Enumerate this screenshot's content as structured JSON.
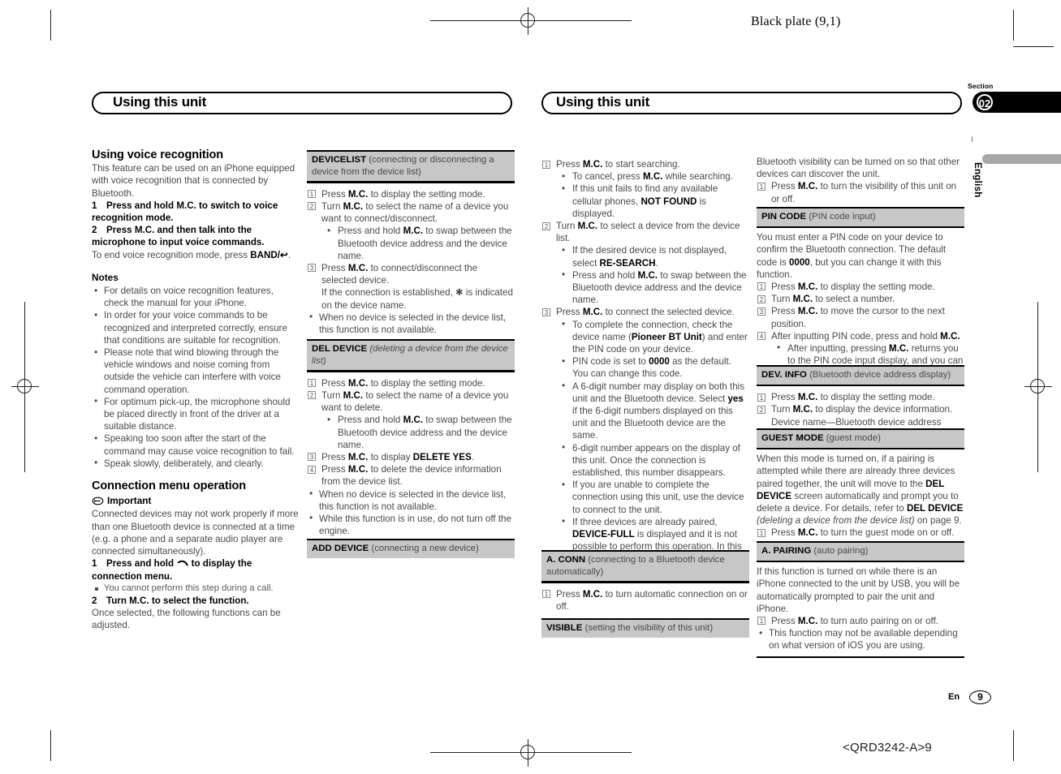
{
  "print_marks": {
    "black_plate": "Black plate (9,1)",
    "code": "<QRD3242-A>9"
  },
  "left_page": {
    "banner_title": "Using this unit",
    "column1": {
      "heading": "Using voice recognition",
      "intro": "This feature can be used on an iPhone equipped with voice recognition that is connected by Bluetooth.",
      "step1": "Press and hold M.C. to switch to voice recognition mode.",
      "step1_num": "1",
      "step2": "Press M.C. and then talk into the microphone to input voice commands.",
      "step2_num": "2",
      "step2_sub": "To end voice recognition mode, press BAND/",
      "notes_heading": "Notes",
      "notes": [
        "For details on voice recognition features, check the manual for your iPhone.",
        "In order for your voice commands to be recognized and interpreted correctly, ensure that conditions are suitable for recognition.",
        "Please note that wind blowing through the vehicle windows and noise coming from outside the vehicle can interfere with voice command operation.",
        "For optimum pick-up, the microphone should be placed directly in front of the driver at a suitable distance.",
        "Speaking too soon after the start of the command may cause voice recognition to fail.",
        "Speak slowly, deliberately, and clearly."
      ],
      "connection_heading": "Connection menu operation",
      "important_label": "Important",
      "important_text": "Connected devices may not work properly if more than one Bluetooth device is connected at a time (e.g. a phone and a separate audio player are connected simultaneously).",
      "conn_step1_num": "1",
      "conn_step1_a": "Press and hold",
      "conn_step1_b": "to display the connection menu.",
      "conn_step1_note": "You cannot perform this step during a call.",
      "conn_step2_num": "2",
      "conn_step2": "Turn M.C. to select the function.",
      "conn_step2_sub": "Once selected, the following functions can be adjusted."
    },
    "column2": {
      "devicelist": {
        "name": "DEVICELIST",
        "desc": "(connecting or disconnecting a device from the device list)",
        "steps": [
          {
            "num": "1",
            "text": "Press M.C. to display the setting mode."
          },
          {
            "num": "2",
            "text": "Turn M.C. to select the name of a device you want to connect/disconnect.",
            "subs": [
              "Press and hold M.C. to swap between the Bluetooth device address and the device name."
            ]
          },
          {
            "num": "3",
            "text": "Press M.C. to connect/disconnect the selected device.",
            "extra": "If the connection is established, ✱ is indicated on the device name."
          }
        ],
        "trailing_bullets": [
          "When no device is selected in the device list, this function is not available."
        ]
      },
      "del_device": {
        "name": "DEL DEVICE",
        "desc": "(deleting a device from the device list)",
        "steps": [
          {
            "num": "1",
            "text": "Press M.C. to display the setting mode."
          },
          {
            "num": "2",
            "text": "Turn M.C. to select the name of a device you want to delete.",
            "subs": [
              "Press and hold M.C. to swap between the Bluetooth device address and the device name."
            ]
          },
          {
            "num": "3",
            "text": "Press M.C. to display DELETE YES."
          },
          {
            "num": "4",
            "text": "Press M.C. to delete the device information from the device list."
          }
        ],
        "trailing_bullets": [
          "When no device is selected in the device list, this function is not available.",
          "While this function is in use, do not turn off the engine."
        ]
      },
      "add_device": {
        "name": "ADD DEVICE",
        "desc": "(connecting a new device)"
      }
    }
  },
  "right_page": {
    "banner_title": "Using this unit",
    "section_label": "Section",
    "section_number": "02",
    "language_tab": "English",
    "column1": {
      "add_device_steps": [
        {
          "num": "1",
          "text": "Press M.C. to start searching.",
          "subs": [
            "To cancel, press M.C. while searching.",
            "If this unit fails to find any available cellular phones, NOT FOUND is displayed."
          ]
        },
        {
          "num": "2",
          "text": "Turn M.C. to select a device from the device list.",
          "subs": [
            "If the desired device is not displayed, select RE-SEARCH.",
            "Press and hold M.C. to swap between the Bluetooth device address and the device name."
          ]
        },
        {
          "num": "3",
          "text": "Press M.C. to connect the selected device.",
          "subs": [
            "To complete the connection, check the device name (Pioneer BT Unit) and enter the PIN code on your device.",
            "PIN code is set to 0000 as the default. You can change this code.",
            "A 6-digit number may display on both this unit and the Bluetooth device. Select yes if the 6-digit numbers displayed on this unit and the Bluetooth device are the same.",
            "6-digit number appears on the display of this unit. Once the connection is established, this number disappears.",
            "If you are unable to complete the connection using this unit, use the device to connect to the unit.",
            "If three devices are already paired, DEVICE-FULL is displayed and it is not possible to perform this operation. In this case, delete a paired device first."
          ]
        }
      ],
      "a_conn": {
        "name": "A. CONN",
        "desc": "(connecting to a Bluetooth device automatically)",
        "steps": [
          {
            "num": "1",
            "text": "Press M.C. to turn automatic connection on or off."
          }
        ]
      },
      "visible": {
        "name": "VISIBLE",
        "desc": "(setting the visibility of this unit)"
      }
    },
    "column2": {
      "visible_body": "Bluetooth visibility can be turned on so that other devices can discover the unit.",
      "visible_steps": [
        {
          "num": "1",
          "text": "Press M.C. to turn the visibility of this unit on or off."
        }
      ],
      "pin_code": {
        "name": "PIN CODE",
        "desc": "(PIN code input)",
        "body": "You must enter a PIN code on your device to confirm the Bluetooth connection. The default code is 0000, but you can change it with this function.",
        "steps": [
          {
            "num": "1",
            "text": "Press M.C. to display the setting mode."
          },
          {
            "num": "2",
            "text": "Turn M.C. to select a number."
          },
          {
            "num": "3",
            "text": "Press M.C. to move the cursor to the next position."
          },
          {
            "num": "4",
            "text": "After inputting PIN code, press and hold M.C.",
            "subs": [
              "After inputting, pressing M.C. returns you to the PIN code input display, and you can change the PIN code."
            ]
          }
        ]
      },
      "dev_info": {
        "name": "DEV. INFO",
        "desc": "(Bluetooth device address display)",
        "steps": [
          {
            "num": "1",
            "text": "Press M.C. to display the setting mode."
          },
          {
            "num": "2",
            "text": "Turn M.C. to display the device information.",
            "extra": "Device name—Bluetooth device address"
          }
        ]
      },
      "guest_mode": {
        "name": "GUEST MODE",
        "desc": "(guest mode)",
        "body": "When this mode is turned on, if a pairing is attempted while there are already three devices paired together, the unit will move to the DEL DEVICE screen automatically and prompt you to delete a device. For details, refer to DEL DEVICE (deleting a device from the device list) on page 9.",
        "steps": [
          {
            "num": "1",
            "text": "Press M.C. to turn the guest mode on or off."
          }
        ]
      },
      "a_pairing": {
        "name": "A. PAIRING",
        "desc": "(auto pairing)",
        "body": "If this function is turned on while there is an iPhone connected to the unit by USB, you will be automatically prompted to pair the unit and iPhone.",
        "steps": [
          {
            "num": "1",
            "text": "Press M.C. to turn auto pairing on or off."
          }
        ],
        "trailing_bullets": [
          "This function may not be available depending on what version of iOS you are using."
        ]
      }
    }
  },
  "footer": {
    "language": "En",
    "page_number": "9"
  }
}
